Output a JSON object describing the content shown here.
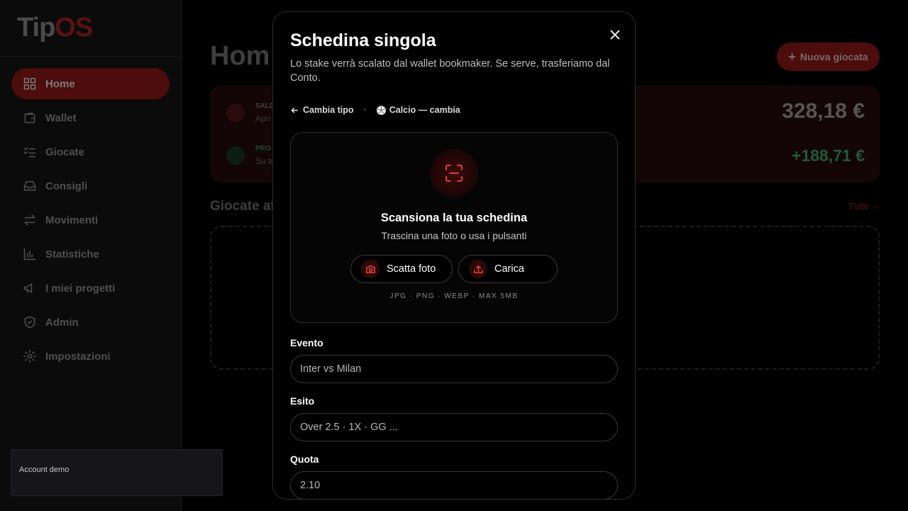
{
  "app": {
    "logo_tip": "Tip",
    "logo_os": "OS",
    "account_label": "Account demo"
  },
  "sidebar": {
    "items": [
      {
        "label": "Home",
        "icon": "grid-icon",
        "active": true
      },
      {
        "label": "Wallet",
        "icon": "wallet-icon"
      },
      {
        "label": "Giocate",
        "icon": "list-check-icon"
      },
      {
        "label": "Consigli",
        "icon": "inbox-icon"
      },
      {
        "label": "Movimenti",
        "icon": "arrows-left-right-icon"
      },
      {
        "label": "Statistiche",
        "icon": "bar-chart-icon"
      },
      {
        "label": "I miei progetti",
        "icon": "megaphone-icon"
      },
      {
        "label": "Admin",
        "icon": "shield-check-icon"
      },
      {
        "label": "Impostazioni",
        "icon": "gear-icon"
      }
    ]
  },
  "main": {
    "title": "Hom",
    "new_button": "Nuova giocata",
    "balance": {
      "label": "SALD",
      "sub": "Apri",
      "value": "328,18 €"
    },
    "profit": {
      "label": "PRO",
      "sub": "Su tu",
      "value": "+188,71 €"
    },
    "section_title": "Giocate at",
    "section_link": "Tutte →"
  },
  "modal": {
    "title": "Schedina singola",
    "description": "Lo stake verrà scalato dal wallet bookmaker. Se serve, trasferiamo dal Conto.",
    "back_label": "Cambia tipo",
    "separator": "·",
    "sport_label": "Calcio — cambia",
    "scan": {
      "title": "Scansiona la tua schedina",
      "subtitle": "Trascina una foto o usa i pulsanti",
      "photo_button": "Scatta foto",
      "upload_button": "Carica",
      "formats": "JPG · PNG · WEBP · MAX 5MB"
    },
    "fields": {
      "event_label": "Evento",
      "event_placeholder": "Inter vs Milan",
      "outcome_label": "Esito",
      "outcome_placeholder": "Over 2.5 · 1X · GG ...",
      "odds_label": "Quota",
      "odds_placeholder": "2.10"
    }
  },
  "colors": {
    "accent": "#e23b3b",
    "positive": "#1f5a36",
    "surface": "#000000"
  }
}
